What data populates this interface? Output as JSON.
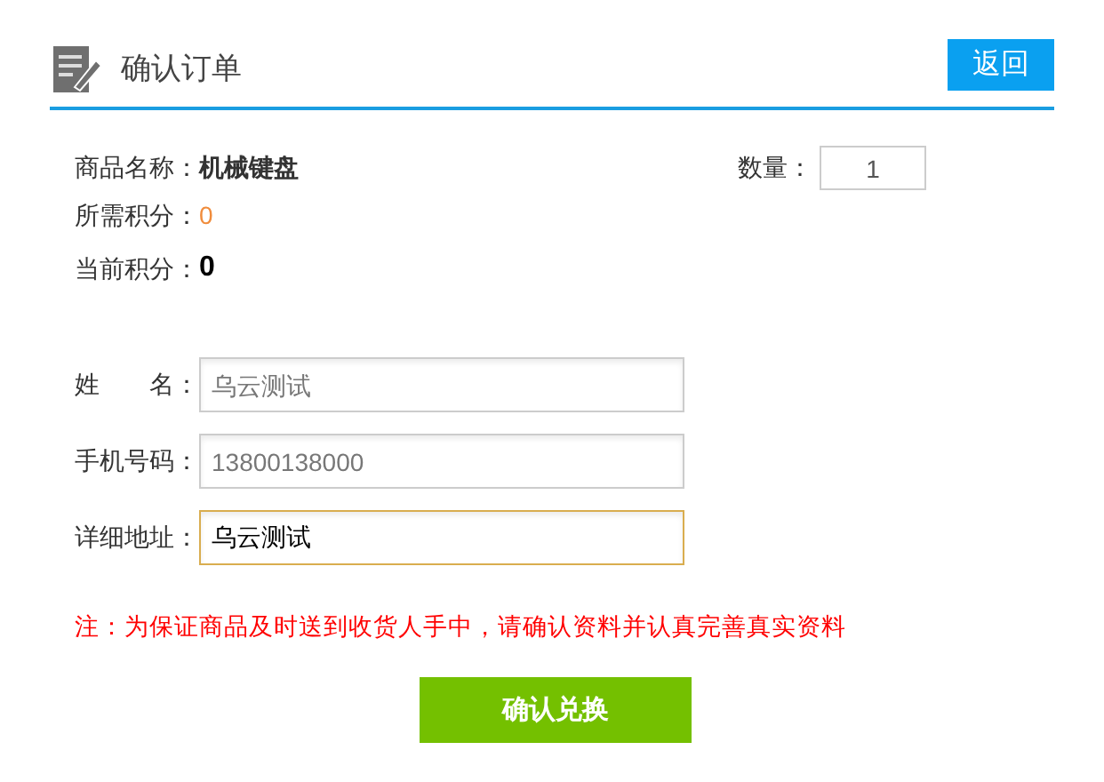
{
  "header": {
    "title": "确认订单",
    "back_button": "返回"
  },
  "product": {
    "name_label": "商品名称：",
    "name": "机械键盘",
    "points_label": "所需积分：",
    "points": "0",
    "current_label": "当前积分：",
    "current": "0",
    "quantity_label": "数量：",
    "quantity": "1"
  },
  "fields": [
    {
      "label": "姓　　名：",
      "placeholder": "乌云测试",
      "focused": false
    },
    {
      "label": "手机号码：",
      "placeholder": "13800138000",
      "focused": false
    },
    {
      "label": "详细地址：",
      "value": "乌云测试",
      "focused": true
    }
  ],
  "note": "注：为保证商品及时送到收货人手中，请确认资料并认真完善真实资料",
  "submit_button": "确认兑换"
}
